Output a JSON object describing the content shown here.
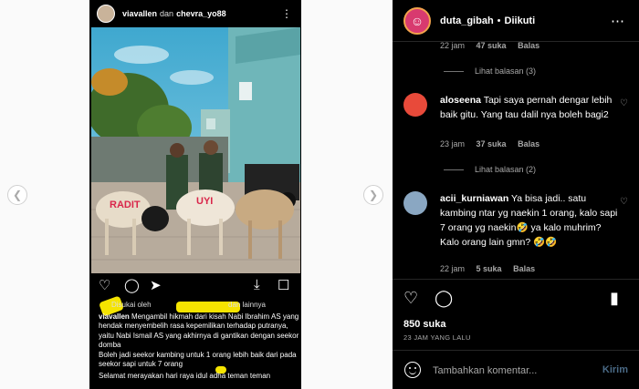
{
  "post": {
    "header": {
      "user": "viavallen",
      "and": "dan",
      "coauthor": "chevra_yo88"
    },
    "liked_by": {
      "prefix": "Disukai oleh",
      "suffix": "dan lainnya"
    },
    "caption": {
      "user": "viavallen",
      "text": "Mengambil hikmah dari kisah Nabi Ibrahim AS yang hendak menyembelih rasa kepemilikan terhadap putranya, yaitu Nabi Ismail AS yang akhirnya di gantikan dengan seekor domba",
      "line2": "Boleh jadi seekor kambing untuk 1 orang lebih baik dari pada seekor sapi untuk 7 orang",
      "line3": "Selamat merayakan hari raya idul adha teman teman"
    },
    "photo_labels": {
      "goat1": "RADIT",
      "goat2": "UYI"
    }
  },
  "panel": {
    "user": "duta_gibah",
    "dot": "•",
    "follow_state": "Diikuti",
    "top_meta": {
      "time": "22 jam",
      "likes": "47 suka",
      "reply": "Balas"
    },
    "comments": [
      {
        "user": "aloseena",
        "text": "Tapi saya pernah dengar lebih baik gitu. Yang tau dalil nya boleh bagi2",
        "time": "23 jam",
        "likes": "37 suka",
        "reply": "Balas"
      },
      {
        "user": "acii_kurniawan",
        "text": "Ya bisa jadi.. satu kambing ntar yg naekin 1 orang, kalo sapi 7 orang yg naekin🤣 ya kalo muhrim? Kalo orang lain gmn? 🤣🤣",
        "time": "22 jam",
        "likes": "5 suka",
        "reply": "Balas"
      }
    ],
    "view_replies": [
      "Lihat balasan (3)",
      "Lihat balasan (2)"
    ],
    "likes": "850 suka",
    "time_ago": "23 JAM YANG LALU",
    "comment_placeholder": "Tambahkan komentar...",
    "send_label": "Kirim"
  },
  "colors": {
    "panel_bg": "#000000",
    "muted": "#a8a8a8",
    "highlight": "#f5e400",
    "send": "#4a6a86"
  }
}
